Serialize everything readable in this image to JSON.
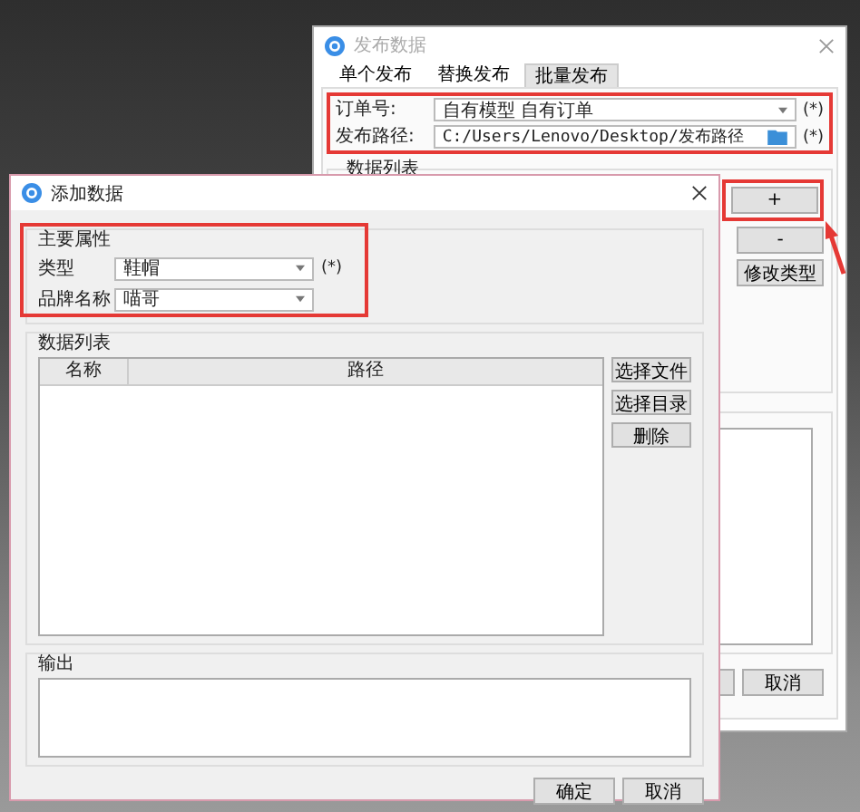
{
  "back_window": {
    "title": "发布数据",
    "tabs": [
      {
        "label": "单个发布",
        "selected": false
      },
      {
        "label": "替换发布",
        "selected": false
      },
      {
        "label": "批量发布",
        "selected": true
      }
    ],
    "order_label": "订单号:",
    "order_value": "自有模型 自有订单",
    "order_required": "(*)",
    "path_label": "发布路径:",
    "path_value": "C:/Users/Lenovo/Desktop/发布路径",
    "path_required": "(*)",
    "group_title": "数据列表",
    "side_buttons": [
      "+",
      "-",
      "修改类型"
    ],
    "footer_buttons": [
      "取消"
    ]
  },
  "dialog": {
    "title": "添加数据",
    "main_group": "主要属性",
    "fields": [
      {
        "label": "类型",
        "value": "鞋帽",
        "required": "(*)"
      },
      {
        "label": "品牌名称",
        "value": "喵哥"
      }
    ],
    "list_group": "数据列表",
    "columns": [
      "名称",
      "路径"
    ],
    "list_buttons": [
      "选择文件",
      "选择目录",
      "删除"
    ],
    "output_group": "输出",
    "buttons": [
      "确定",
      "取消"
    ]
  }
}
